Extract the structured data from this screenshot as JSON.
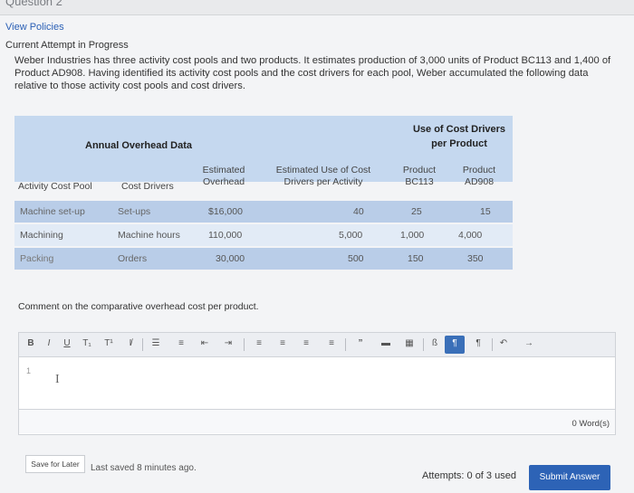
{
  "header": {
    "title_fragment": "Question 2"
  },
  "nav": {
    "view_policies": "View Policies",
    "current_attempt": "Current Attempt in Progress"
  },
  "question": {
    "intro": "Weber Industries has three activity cost pools and two products. It estimates production of 3,000 units of Product BC113 and 1,400 of Product AD908. Having identified its activity cost pools and the cost drivers for each pool, Weber accumulated the following data relative to those activity cost pools and cost drivers."
  },
  "table": {
    "group_header_left": "Annual Overhead Data",
    "group_header_right": "Use of Cost Drivers per Product",
    "columns": {
      "pool": "Activity Cost Pool",
      "drivers": "Cost Drivers",
      "overhead": "Estimated Overhead",
      "use": "Estimated Use of Cost Drivers per Activity",
      "bc113": "Product BC113",
      "ad908": "Product AD908"
    },
    "rows": [
      {
        "pool": "Machine set-up",
        "drivers": "Set-ups",
        "overhead": "$16,000",
        "use": "40",
        "bc113": "25",
        "ad908": "15"
      },
      {
        "pool": "Machining",
        "drivers": "Machine hours",
        "overhead": "110,000",
        "use": "5,000",
        "bc113": "1,000",
        "ad908": "4,000"
      },
      {
        "pool": "Packing",
        "drivers": "Orders",
        "overhead": "30,000",
        "use": "500",
        "bc113": "150",
        "ad908": "350"
      }
    ]
  },
  "comment": {
    "prompt": "Comment on the comparative overhead cost per product.",
    "text": "",
    "line_marker": "1",
    "word_count": "0 Word(s)"
  },
  "toolbar": {
    "bold": "B",
    "italic": "I",
    "underline": "U",
    "subscript": "T₁",
    "superscript": "T¹",
    "clear_format": "I̸",
    "bullet_list": "☰",
    "numbered_list": "≡",
    "outdent": "⇤",
    "indent": "⇥",
    "align_left": "≡",
    "align_center": "≡",
    "align_right": "≡",
    "justify": "≡",
    "quote": "”",
    "hr": "▬",
    "table": "▦",
    "special_char": "ß",
    "ltr": "¶",
    "rtl": "¶",
    "undo": "↶",
    "redo": "→"
  },
  "footer": {
    "save_later": "Save for Later",
    "last_saved": "Last saved 8 minutes ago.",
    "attempts": "Attempts: 0 of 3 used",
    "submit": "Submit Answer"
  },
  "colors": {
    "link": "#2a5fb5",
    "table_header_bg": "#c5d8ef",
    "row_a_bg": "#b9cde8",
    "row_b_bg": "#e2ebf6",
    "submit_bg": "#2d63b6",
    "toolbar_active": "#3a6fb8"
  }
}
